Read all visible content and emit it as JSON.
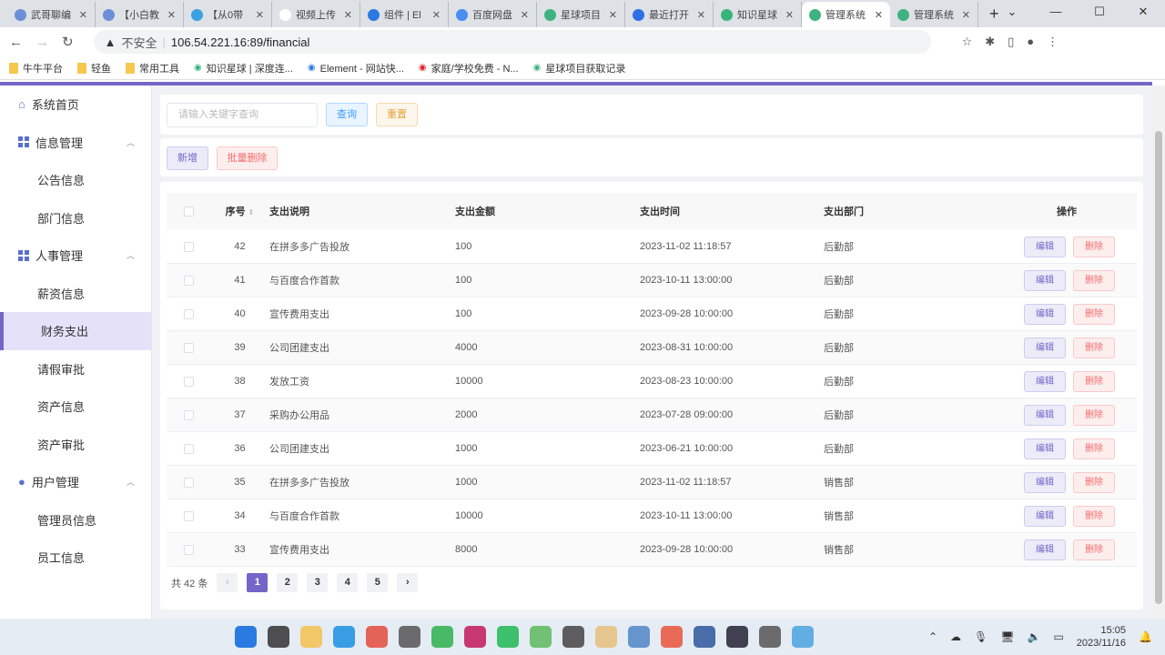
{
  "browser": {
    "tabs": [
      {
        "label": "武哥聊编",
        "color": "#6b8fd6"
      },
      {
        "label": "【小白教",
        "color": "#6b8fd6"
      },
      {
        "label": "【从0带",
        "color": "#3aa0e0"
      },
      {
        "label": "视频上传",
        "color": "#ffffff"
      },
      {
        "label": "组件 | El",
        "color": "#2a7ae2"
      },
      {
        "label": "百度网盘",
        "color": "#4a8cf0"
      },
      {
        "label": "星球项目",
        "color": "#3fb37f"
      },
      {
        "label": "最近打开",
        "color": "#2f6fe8"
      },
      {
        "label": "知识星球",
        "color": "#39b37a"
      },
      {
        "label": "管理系统",
        "color": "#3fb37f"
      },
      {
        "label": "管理系统",
        "color": "#3fb37f"
      }
    ],
    "active_tab": 9,
    "security": "不安全",
    "url": "106.54.221.16:89/financial",
    "bookmarks": [
      "牛牛平台",
      "轻鱼",
      "常用工具",
      "知识星球 | 深度连...",
      "Element - 网站快...",
      "家庭/学校免费 - N...",
      "星球项目获取记录"
    ]
  },
  "sidebar": {
    "items": [
      {
        "label": "系统首页",
        "type": "top",
        "icon": "home-icon"
      },
      {
        "label": "信息管理",
        "type": "group",
        "icon": "grid-icon"
      },
      {
        "label": "公告信息",
        "type": "sub"
      },
      {
        "label": "部门信息",
        "type": "sub"
      },
      {
        "label": "人事管理",
        "type": "group",
        "icon": "grid-icon"
      },
      {
        "label": "薪资信息",
        "type": "sub"
      },
      {
        "label": "财务支出",
        "type": "sub",
        "active": true
      },
      {
        "label": "请假审批",
        "type": "sub"
      },
      {
        "label": "资产信息",
        "type": "sub"
      },
      {
        "label": "资产审批",
        "type": "sub"
      },
      {
        "label": "用户管理",
        "type": "group",
        "icon": "user-icon"
      },
      {
        "label": "管理员信息",
        "type": "sub"
      },
      {
        "label": "员工信息",
        "type": "sub"
      }
    ]
  },
  "search": {
    "placeholder": "请输入关键字查询",
    "query": "查询",
    "reset": "重置"
  },
  "toolbar": {
    "add": "新增",
    "batch_delete": "批量删除"
  },
  "table": {
    "headers": [
      "序号",
      "支出说明",
      "支出金额",
      "支出时间",
      "支出部门",
      "操作"
    ],
    "edit": "编辑",
    "delete": "删除",
    "rows": [
      [
        "42",
        "在拼多多广告投放",
        "100",
        "2023-11-02 11:18:57",
        "后勤部"
      ],
      [
        "41",
        "与百度合作首款",
        "100",
        "2023-10-11 13:00:00",
        "后勤部"
      ],
      [
        "40",
        "宣传费用支出",
        "100",
        "2023-09-28 10:00:00",
        "后勤部"
      ],
      [
        "39",
        "公司团建支出",
        "4000",
        "2023-08-31 10:00:00",
        "后勤部"
      ],
      [
        "38",
        "发放工资",
        "10000",
        "2023-08-23 10:00:00",
        "后勤部"
      ],
      [
        "37",
        "采购办公用品",
        "2000",
        "2023-07-28 09:00:00",
        "后勤部"
      ],
      [
        "36",
        "公司团建支出",
        "1000",
        "2023-06-21 10:00:00",
        "后勤部"
      ],
      [
        "35",
        "在拼多多广告投放",
        "1000",
        "2023-11-02 11:18:57",
        "销售部"
      ],
      [
        "34",
        "与百度合作首款",
        "10000",
        "2023-10-11 13:00:00",
        "销售部"
      ],
      [
        "33",
        "宣传费用支出",
        "8000",
        "2023-09-28 10:00:00",
        "销售部"
      ]
    ]
  },
  "pagination": {
    "total": "共 42 条",
    "pages": [
      "1",
      "2",
      "3",
      "4",
      "5"
    ],
    "current": "1",
    "prev": "‹",
    "next": "›"
  },
  "taskbar": {
    "time": "15:05",
    "date": "2023/11/16"
  }
}
